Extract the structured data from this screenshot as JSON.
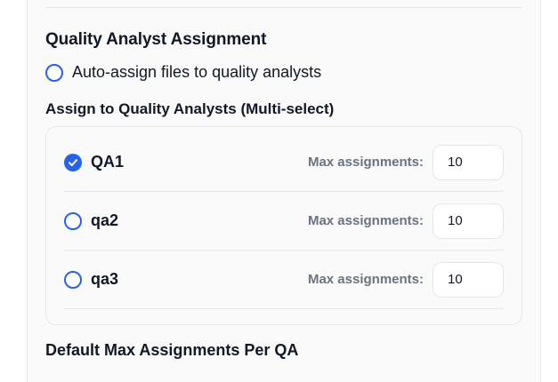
{
  "section": {
    "title": "Quality Analyst Assignment",
    "auto_assign_label": "Auto-assign files to quality analysts"
  },
  "analysts_section": {
    "title": "Assign to Quality Analysts (Multi-select)",
    "max_label": "Max assignments:",
    "analysts": [
      {
        "name": "QA1",
        "checked": true,
        "max": "10"
      },
      {
        "name": "qa2",
        "checked": false,
        "max": "10"
      },
      {
        "name": "qa3",
        "checked": false,
        "max": "10"
      }
    ]
  },
  "default_section": {
    "title": "Default Max Assignments Per QA"
  },
  "colors": {
    "accent": "#2563eb",
    "muted_text": "#6b7280",
    "border": "#e5e7eb"
  }
}
